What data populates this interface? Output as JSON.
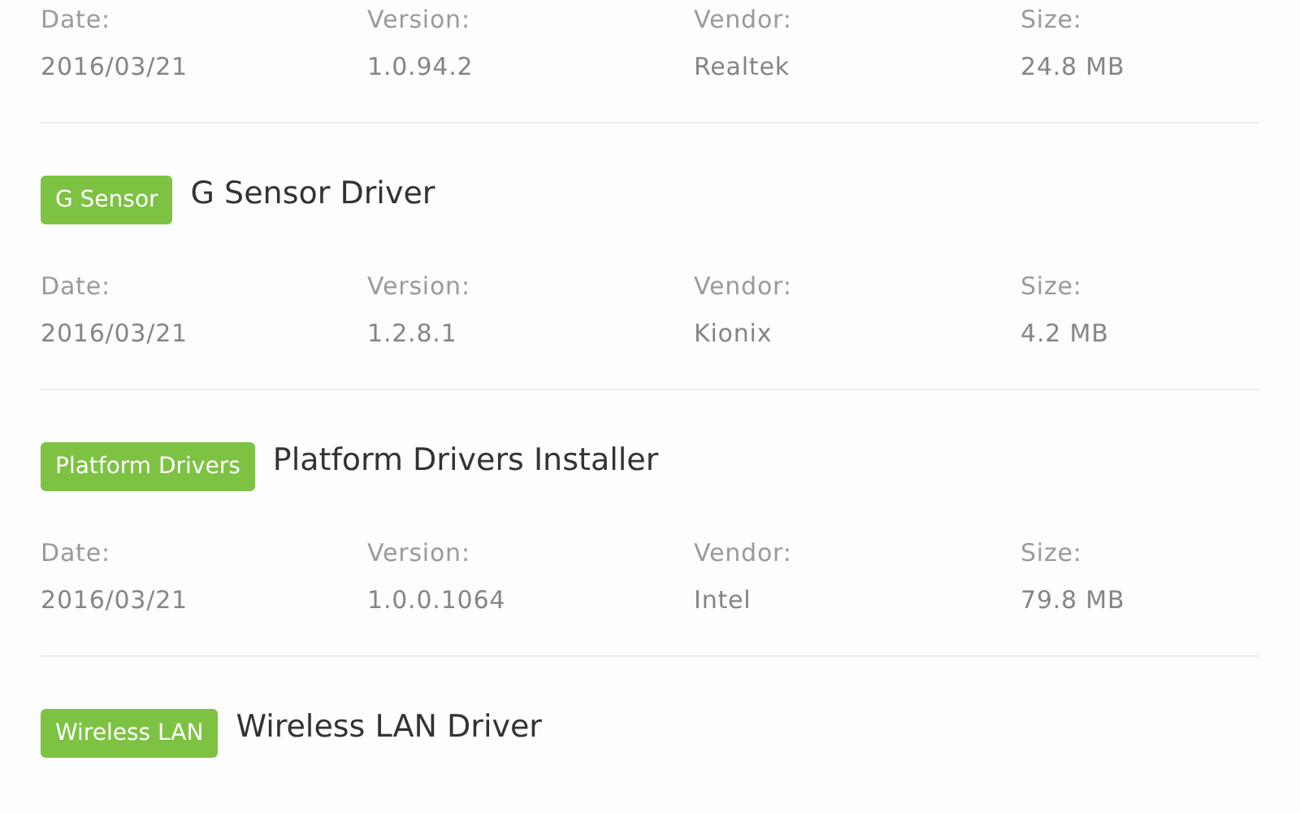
{
  "drivers": [
    {
      "fields": [
        {
          "label": "Date:",
          "value": "2016/03/21"
        },
        {
          "label": "Version:",
          "value": "1.0.94.2"
        },
        {
          "label": "Vendor:",
          "value": "Realtek"
        },
        {
          "label": "Size:",
          "value": "24.8 MB"
        }
      ]
    },
    {
      "badge": "G Sensor",
      "title": "G Sensor Driver",
      "fields": [
        {
          "label": "Date:",
          "value": "2016/03/21"
        },
        {
          "label": "Version:",
          "value": "1.2.8.1"
        },
        {
          "label": "Vendor:",
          "value": "Kionix"
        },
        {
          "label": "Size:",
          "value": "4.2 MB"
        }
      ]
    },
    {
      "badge": "Platform Drivers",
      "title": "Platform Drivers Installer",
      "fields": [
        {
          "label": "Date:",
          "value": "2016/03/21"
        },
        {
          "label": "Version:",
          "value": "1.0.0.1064"
        },
        {
          "label": "Vendor:",
          "value": "Intel"
        },
        {
          "label": "Size:",
          "value": "79.8 MB"
        }
      ]
    },
    {
      "badge": "Wireless LAN",
      "title": "Wireless LAN Driver"
    }
  ]
}
